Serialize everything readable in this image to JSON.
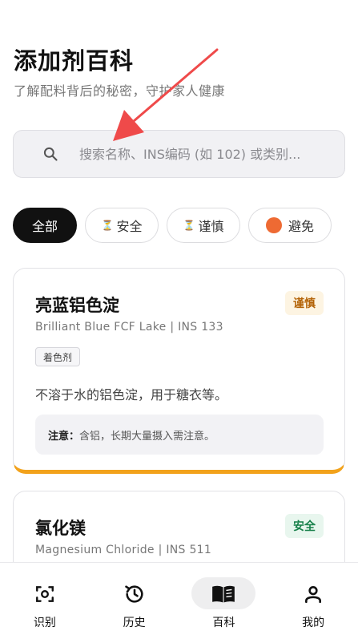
{
  "header": {
    "title": "添加剂百科",
    "subtitle": "了解配料背后的秘密，守护家人健康"
  },
  "search": {
    "placeholder": "搜索名称、INS编码 (如 102) 或类别..."
  },
  "filters": [
    {
      "label": "全部",
      "active": true
    },
    {
      "label": "安全",
      "icon": "hourglass-icon"
    },
    {
      "label": "谨慎",
      "icon": "hourglass-icon"
    },
    {
      "label": "避免",
      "icon": "orange-dot-icon"
    }
  ],
  "filter_glyph": "⏳",
  "colors": {
    "accent_caution": "#f2a21b",
    "avoid_dot": "#ee6a33",
    "safe_green": "#17804a",
    "caution_text": "#b46408"
  },
  "items": [
    {
      "name": "亮蓝铝色淀",
      "subtitle": "Brilliant Blue FCF Lake | INS 133",
      "badge": "谨慎",
      "tag": "着色剂",
      "description": "不溶于水的铝色淀，用于糖衣等。",
      "note_label": "注意：",
      "note_text": "含铝，长期大量摄入需注意。"
    },
    {
      "name": "氯化镁",
      "subtitle": "Magnesium Chloride | INS 511",
      "badge": "安全"
    }
  ],
  "tabbar": [
    {
      "label": "识别",
      "icon": "scan-icon"
    },
    {
      "label": "历史",
      "icon": "history-icon"
    },
    {
      "label": "百科",
      "icon": "book-icon",
      "active": true
    },
    {
      "label": "我的",
      "icon": "person-icon"
    }
  ]
}
